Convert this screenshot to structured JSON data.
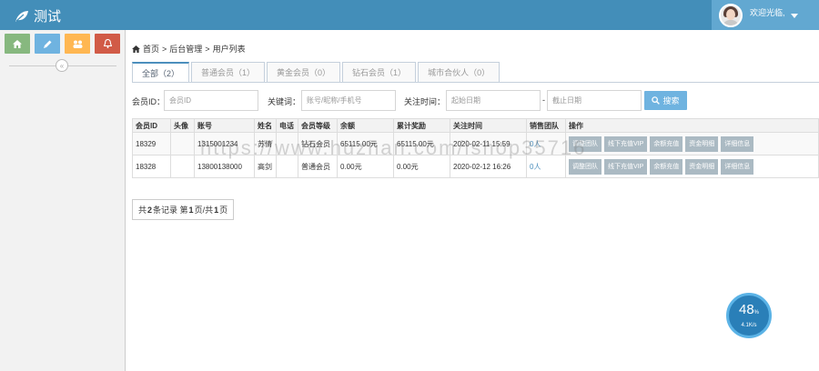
{
  "header": {
    "title": "测试",
    "user_greeting": "欢迎光临,",
    "bg_color": "#438eb9"
  },
  "sidebar": {
    "shortcuts": [
      {
        "icon": "home-icon",
        "color": "#87b87f"
      },
      {
        "icon": "pencil-icon",
        "color": "#6fb3e0"
      },
      {
        "icon": "group-icon",
        "color": "#ffb752"
      },
      {
        "icon": "bell-icon",
        "color": "#d15b47"
      }
    ],
    "collapse_glyph": "«"
  },
  "breadcrumb": {
    "home": "首页",
    "sep1": ">",
    "section": "后台管理",
    "sep2": ">",
    "current": "用户列表"
  },
  "tabs": [
    "全部（2）",
    "普通会员（1）",
    "黄金会员（0）",
    "钻石会员（1）",
    "城市合伙人（0）"
  ],
  "filters": {
    "member_id_label": "会员ID：",
    "member_id_placeholder": "会员ID",
    "keyword_label": "关键词：",
    "keyword_placeholder": "账号/昵称/手机号",
    "time_label": "关注时间：",
    "start_placeholder": "起始日期",
    "dash": "-",
    "end_placeholder": "截止日期",
    "search_label": "搜索"
  },
  "table": {
    "headers": [
      "会员ID",
      "头像",
      "账号",
      "姓名",
      "电话",
      "会员等级",
      "余额",
      "累计奖励",
      "关注时间",
      "销售团队",
      "操作"
    ],
    "rows": [
      {
        "id": "18329",
        "avatar": "",
        "account": "1315001234",
        "name": "苏倩",
        "phone": "",
        "level": "钻石会员",
        "balance": "65115.00元",
        "reward": "65115.00元",
        "time": "2020-02-11 15:59",
        "team": "0人"
      },
      {
        "id": "18328",
        "avatar": "",
        "account": "13800138000",
        "name": "高剑",
        "phone": "",
        "level": "普通会员",
        "balance": "0.00元",
        "reward": "0.00元",
        "time": "2020-02-12 16:26",
        "team": "0人"
      }
    ],
    "ops": [
      "调整团队",
      "线下充值VIP",
      "余额充值",
      "资金明细",
      "详细信息"
    ]
  },
  "pager": {
    "prefix": "共",
    "total": "2",
    "mid": "条记录 第",
    "page": "1",
    "mid2": "页/共",
    "pages": "1",
    "suffix": "页"
  },
  "watermark": "https://www.huzhan.com/ishop35716",
  "speed_widget": {
    "percent": "48",
    "percent_unit": "%",
    "speed": "4.1K/s"
  }
}
